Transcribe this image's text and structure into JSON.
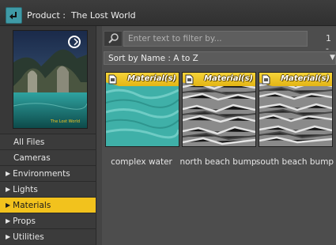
{
  "header": {
    "back_icon": "back-arrow-icon",
    "title": "Product :  The Lost World"
  },
  "preview": {
    "label": "The Lost World"
  },
  "nav": [
    {
      "label": "All Files",
      "expandable": false
    },
    {
      "label": "Cameras",
      "expandable": false
    },
    {
      "label": "Environments",
      "expandable": true
    },
    {
      "label": "Lights",
      "expandable": true
    },
    {
      "label": "Materials",
      "expandable": true,
      "selected": true
    },
    {
      "label": "Props",
      "expandable": true
    },
    {
      "label": "Utilities",
      "expandable": true
    }
  ],
  "filter": {
    "placeholder": "Enter text to filter by...",
    "count": "1 -"
  },
  "sort": {
    "value": "Sort by Name : A to Z"
  },
  "items": [
    {
      "tag": "Material(s)",
      "name": "complex water"
    },
    {
      "tag": "Material(s)",
      "name": "north beach bump"
    },
    {
      "tag": "Material(s)",
      "name": "south beach bump"
    }
  ],
  "colors": {
    "accent": "#f2c21d",
    "back_button": "#3f9aa6"
  }
}
